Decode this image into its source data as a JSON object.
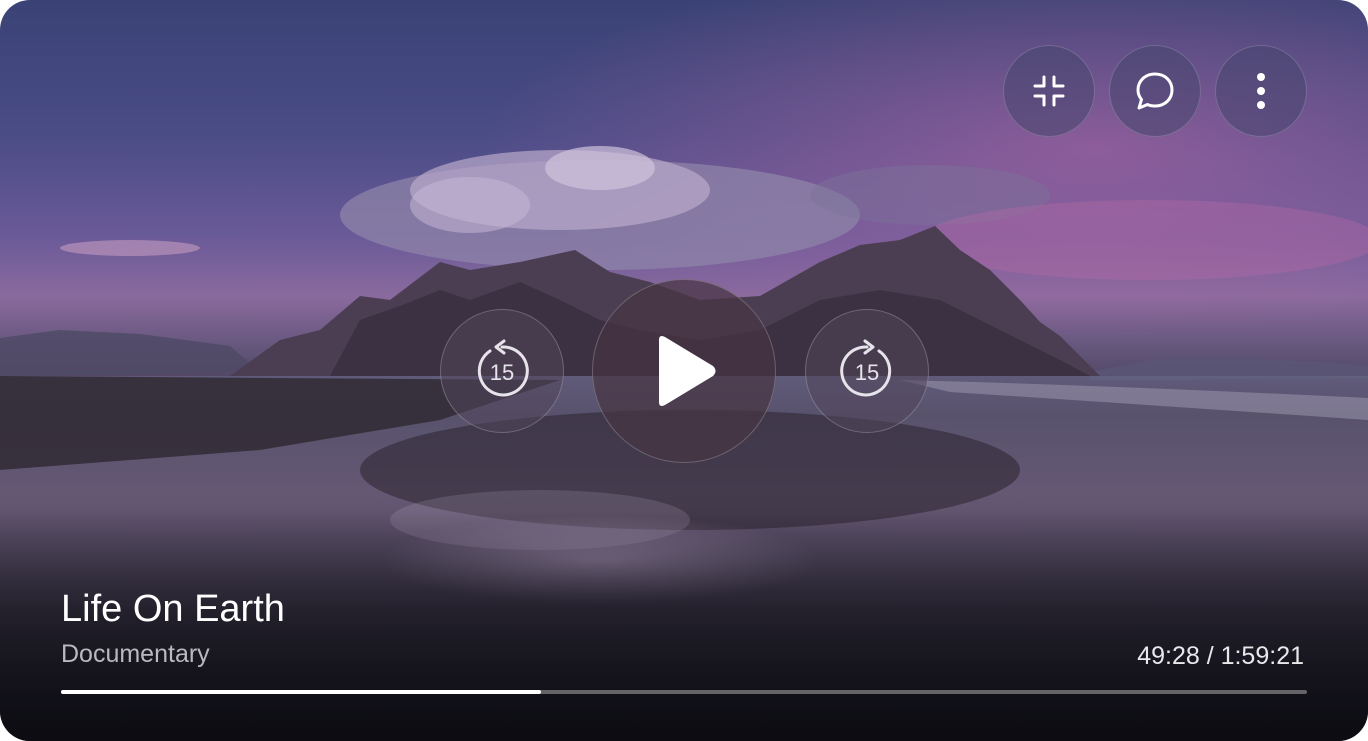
{
  "video": {
    "title": "Life On Earth",
    "genre": "Documentary",
    "elapsed": "49:28",
    "duration": "1:59:21",
    "time_display": "49:28 / 1:59:21",
    "progress_fraction": 0.385
  },
  "controls": {
    "rewind_seconds": "15",
    "forward_seconds": "15"
  },
  "icons": {
    "exit_fullscreen": "exit-fullscreen-icon",
    "comments": "chat-bubble-icon",
    "more": "more-vertical-icon",
    "rewind": "rewind-15-icon",
    "play": "play-icon",
    "forward": "forward-15-icon"
  }
}
